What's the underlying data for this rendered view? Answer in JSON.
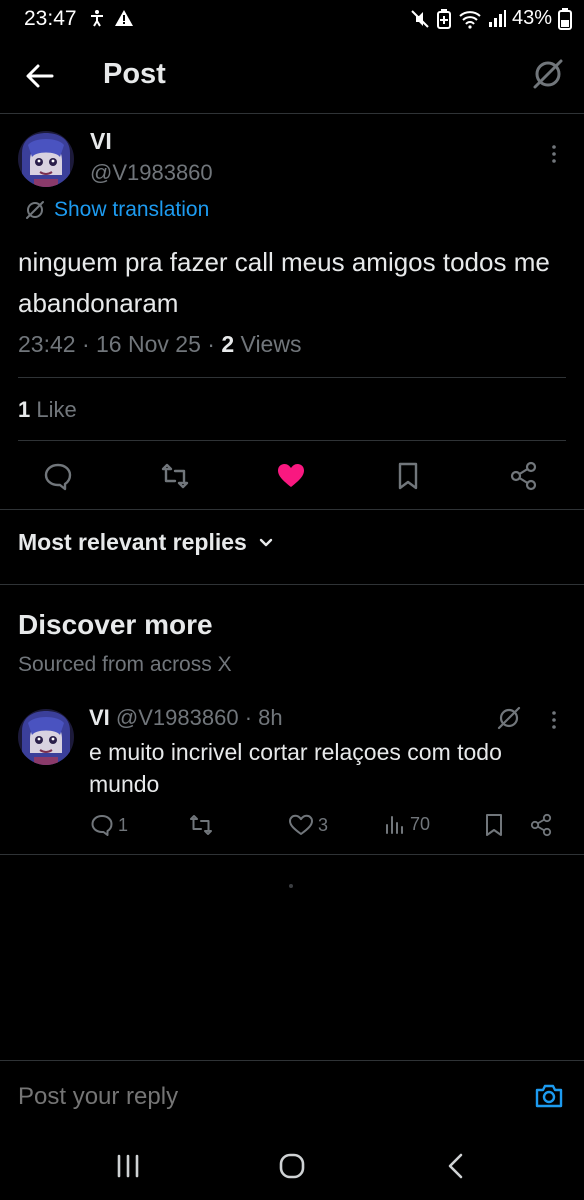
{
  "status_bar": {
    "time": "23:47",
    "battery": "43%",
    "left_icons": [
      "accessibility-icon",
      "warning-icon"
    ],
    "right_icons": [
      "mute-icon",
      "battery-saver-icon",
      "wifi-icon",
      "signal-icon",
      "battery-icon"
    ]
  },
  "header": {
    "title": "Post",
    "back_icon": "arrow-left-icon",
    "grok_icon": "grok-icon"
  },
  "post": {
    "author_name": "VI",
    "author_handle": "@V1983860",
    "translation_label": "Show translation",
    "text": "ninguem pra fazer call meus amigos todos me abandonaram",
    "time": "23:42",
    "date": "16 Nov 25",
    "views_count": "2",
    "views_label": "Views",
    "likes_count": "1",
    "likes_label": "Like",
    "liked": true
  },
  "actions": [
    "reply-icon",
    "repost-icon",
    "like-icon",
    "bookmark-icon",
    "share-icon"
  ],
  "replies": {
    "sort_label": "Most relevant replies"
  },
  "discover": {
    "title": "Discover more",
    "subtitle": "Sourced from across X",
    "items": [
      {
        "author_name": "VI",
        "author_handle": "@V1983860",
        "age": "8h",
        "text": "e muito incrivel cortar relaçoes com todo mundo",
        "replies": "1",
        "reposts": "",
        "likes": "3",
        "views": "70"
      }
    ]
  },
  "reply_bar": {
    "placeholder": "Post your reply"
  },
  "colors": {
    "background": "#000000",
    "text": "#e7e9ea",
    "muted": "#71767b",
    "accent": "#1d9bf0",
    "like": "#f91880",
    "divider": "#2f3336"
  },
  "nav": [
    "recents-icon",
    "home-icon",
    "back-icon"
  ]
}
